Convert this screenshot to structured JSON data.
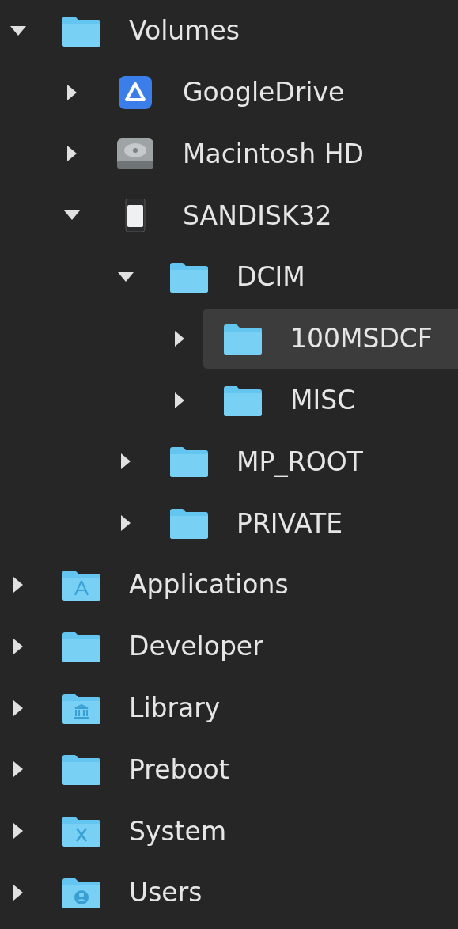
{
  "tree": [
    {
      "label": "Volumes",
      "kind": "folder",
      "expanded": true,
      "selected": false,
      "children": [
        {
          "label": "GoogleDrive",
          "kind": "drive",
          "expanded": false,
          "selected": false
        },
        {
          "label": "Macintosh HD",
          "kind": "disk",
          "expanded": false,
          "selected": false
        },
        {
          "label": "SANDISK32",
          "kind": "card",
          "expanded": true,
          "selected": false,
          "children": [
            {
              "label": "DCIM",
              "kind": "folder",
              "expanded": true,
              "selected": false,
              "children": [
                {
                  "label": "100MSDCF",
                  "kind": "folder",
                  "expanded": false,
                  "selected": true
                },
                {
                  "label": "MISC",
                  "kind": "folder",
                  "expanded": false,
                  "selected": false
                }
              ]
            },
            {
              "label": "MP_ROOT",
              "kind": "folder",
              "expanded": false,
              "selected": false
            },
            {
              "label": "PRIVATE",
              "kind": "folder",
              "expanded": false,
              "selected": false
            }
          ]
        }
      ]
    },
    {
      "label": "Applications",
      "kind": "apps",
      "expanded": false,
      "selected": false
    },
    {
      "label": "Developer",
      "kind": "folder",
      "expanded": false,
      "selected": false
    },
    {
      "label": "Library",
      "kind": "library",
      "expanded": false,
      "selected": false
    },
    {
      "label": "Preboot",
      "kind": "folder",
      "expanded": false,
      "selected": false
    },
    {
      "label": "System",
      "kind": "system",
      "expanded": false,
      "selected": false
    },
    {
      "label": "Users",
      "kind": "users",
      "expanded": false,
      "selected": false
    }
  ]
}
